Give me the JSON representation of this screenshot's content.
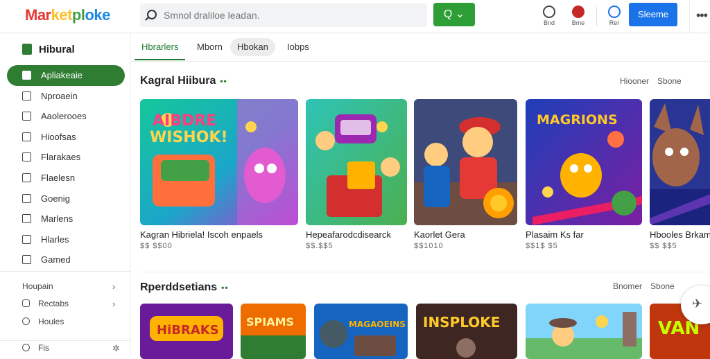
{
  "app": {
    "logo_parts": [
      "Mar",
      "ket",
      "pl",
      "oke"
    ]
  },
  "search": {
    "placeholder": "Smnol draliloe leadan.",
    "button_label": "Q ⌄"
  },
  "toolbar": {
    "icon1_label": "Bnd",
    "icon2_label": "Bme",
    "icon3_label": "Rer",
    "signin_label": "Sleeme",
    "more_label": "•••"
  },
  "sidebar": {
    "title": "Hibural",
    "items": [
      {
        "label": "Apliakeaie",
        "icon": "app-icon"
      },
      {
        "label": "Nproaein",
        "icon": "grid-icon"
      },
      {
        "label": "Aaolerooes",
        "icon": "edit-icon"
      },
      {
        "label": "Hioofsas",
        "icon": "folder-icon"
      },
      {
        "label": "Flarakaes",
        "icon": "bookmark-icon"
      },
      {
        "label": "Flaelesn",
        "icon": "search-icon"
      },
      {
        "label": "Goenig",
        "icon": "store-icon"
      },
      {
        "label": "Marlens",
        "icon": "check-icon"
      },
      {
        "label": "Hlarles",
        "icon": "file-icon"
      },
      {
        "label": "Gamed",
        "icon": "game-icon"
      }
    ],
    "sub_title": "Houpain",
    "sub_items": [
      {
        "label": "Rectabs",
        "icon": "tag-icon"
      },
      {
        "label": "Houles",
        "icon": "circle-icon"
      }
    ],
    "bottom_item": {
      "label": "Fis",
      "badge": "✲"
    }
  },
  "tabs": [
    {
      "label": "Hbrarlers",
      "state": "active"
    },
    {
      "label": "Mborn",
      "state": "normal"
    },
    {
      "label": "Hbokan",
      "state": "pill"
    },
    {
      "label": "Iobps",
      "state": "normal"
    }
  ],
  "sections": [
    {
      "title": "Kagral Hiibura",
      "dots": "••",
      "links": [
        "Hiooner",
        "Sbone"
      ],
      "cards": [
        {
          "title": "Kagran Hibriela! Iscoh enpaels",
          "price": "$$ $$00"
        },
        {
          "title": "Hepeafarodcdisearck",
          "price": "$$.$$5"
        },
        {
          "title": "Kaorlet Gera",
          "price": "$$1010"
        },
        {
          "title": "Plasaim Ks far",
          "price": "$$1$ $5"
        },
        {
          "title": "Hbooles Brkam",
          "price": "$$ $$5"
        }
      ]
    },
    {
      "title": "Rperddsetians",
      "dots": "••",
      "links": [
        "Bnomer",
        "Sbone"
      ],
      "cards": [
        {
          "banner": "HiBRAKS"
        },
        {
          "banner": "SPIAMS"
        },
        {
          "banner": "MAGAOEINS"
        },
        {
          "banner": "INSPLOKE"
        },
        {
          "banner": ""
        },
        {
          "banner": "VAN"
        }
      ]
    }
  ],
  "colors": {
    "brand_green": "#2e7d32",
    "accent_blue": "#1a73e8",
    "search_green": "#2e9e37"
  }
}
